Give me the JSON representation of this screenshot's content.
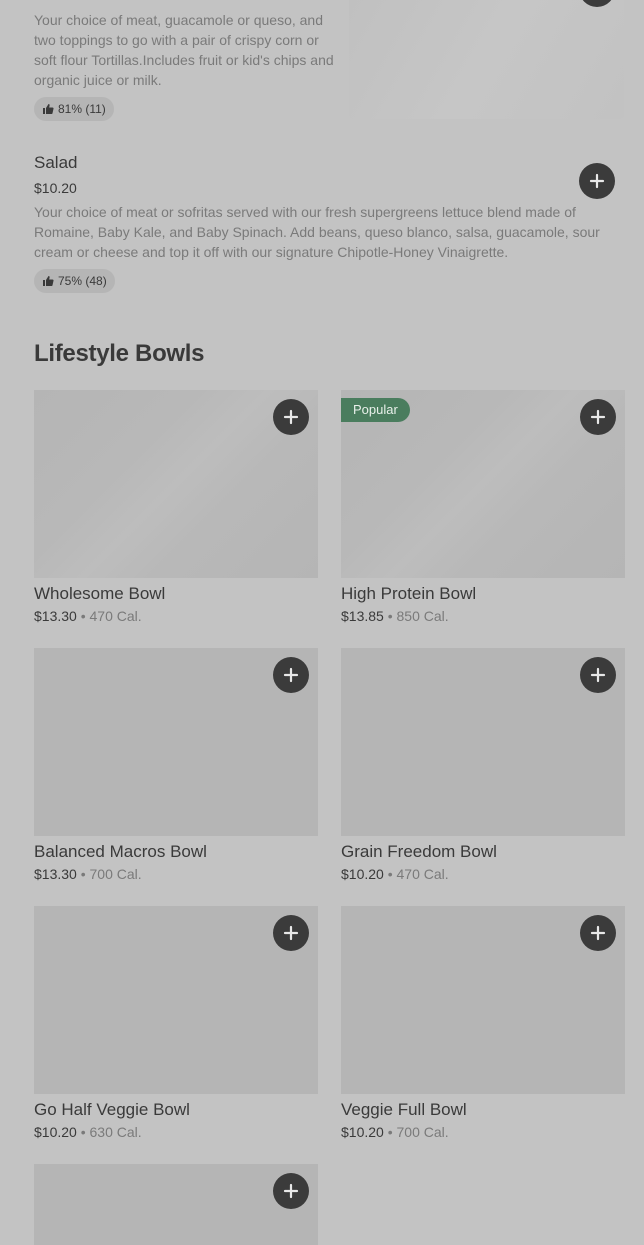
{
  "top_item": {
    "description": "Your choice of meat, guacamole or queso, and two toppings to go with a pair of crispy corn or soft flour Tortillas.Includes fruit or kid's chips and organic juice or milk.",
    "rating": "81% (11)"
  },
  "salad": {
    "title": "Salad",
    "price": "$10.20",
    "description": "Your choice of meat or sofritas served with our fresh supergreens lettuce blend made of Romaine, Baby Kale, and Baby Spinach. Add beans, queso blanco, salsa, guacamole, sour cream or cheese and top it off with our signature Chipotle-Honey Vinaigrette.",
    "rating": "75% (48)"
  },
  "section": {
    "title": "Lifestyle Bowls"
  },
  "cards": [
    {
      "title": "Wholesome Bowl",
      "price": "$13.30",
      "sep": "•",
      "cal": "470 Cal.",
      "badge": ""
    },
    {
      "title": "High Protein Bowl",
      "price": "$13.85",
      "sep": "•",
      "cal": "850 Cal.",
      "badge": "Popular"
    },
    {
      "title": "Balanced Macros Bowl",
      "price": "$13.30",
      "sep": "•",
      "cal": "700 Cal.",
      "badge": ""
    },
    {
      "title": "Grain Freedom Bowl",
      "price": "$10.20",
      "sep": "•",
      "cal": "470 Cal.",
      "badge": ""
    },
    {
      "title": "Go Half Veggie Bowl",
      "price": "$10.20",
      "sep": "•",
      "cal": "630 Cal.",
      "badge": ""
    },
    {
      "title": "Veggie Full Bowl",
      "price": "$10.20",
      "sep": "•",
      "cal": "700 Cal.",
      "badge": ""
    }
  ],
  "colors": {
    "background": "#c3c3c3",
    "button": "#3b3b3b",
    "badge": "#4a7d5e",
    "image_placeholder": "#b5b5b5"
  },
  "icons": [
    "thumbs-up-icon",
    "plus-icon"
  ]
}
